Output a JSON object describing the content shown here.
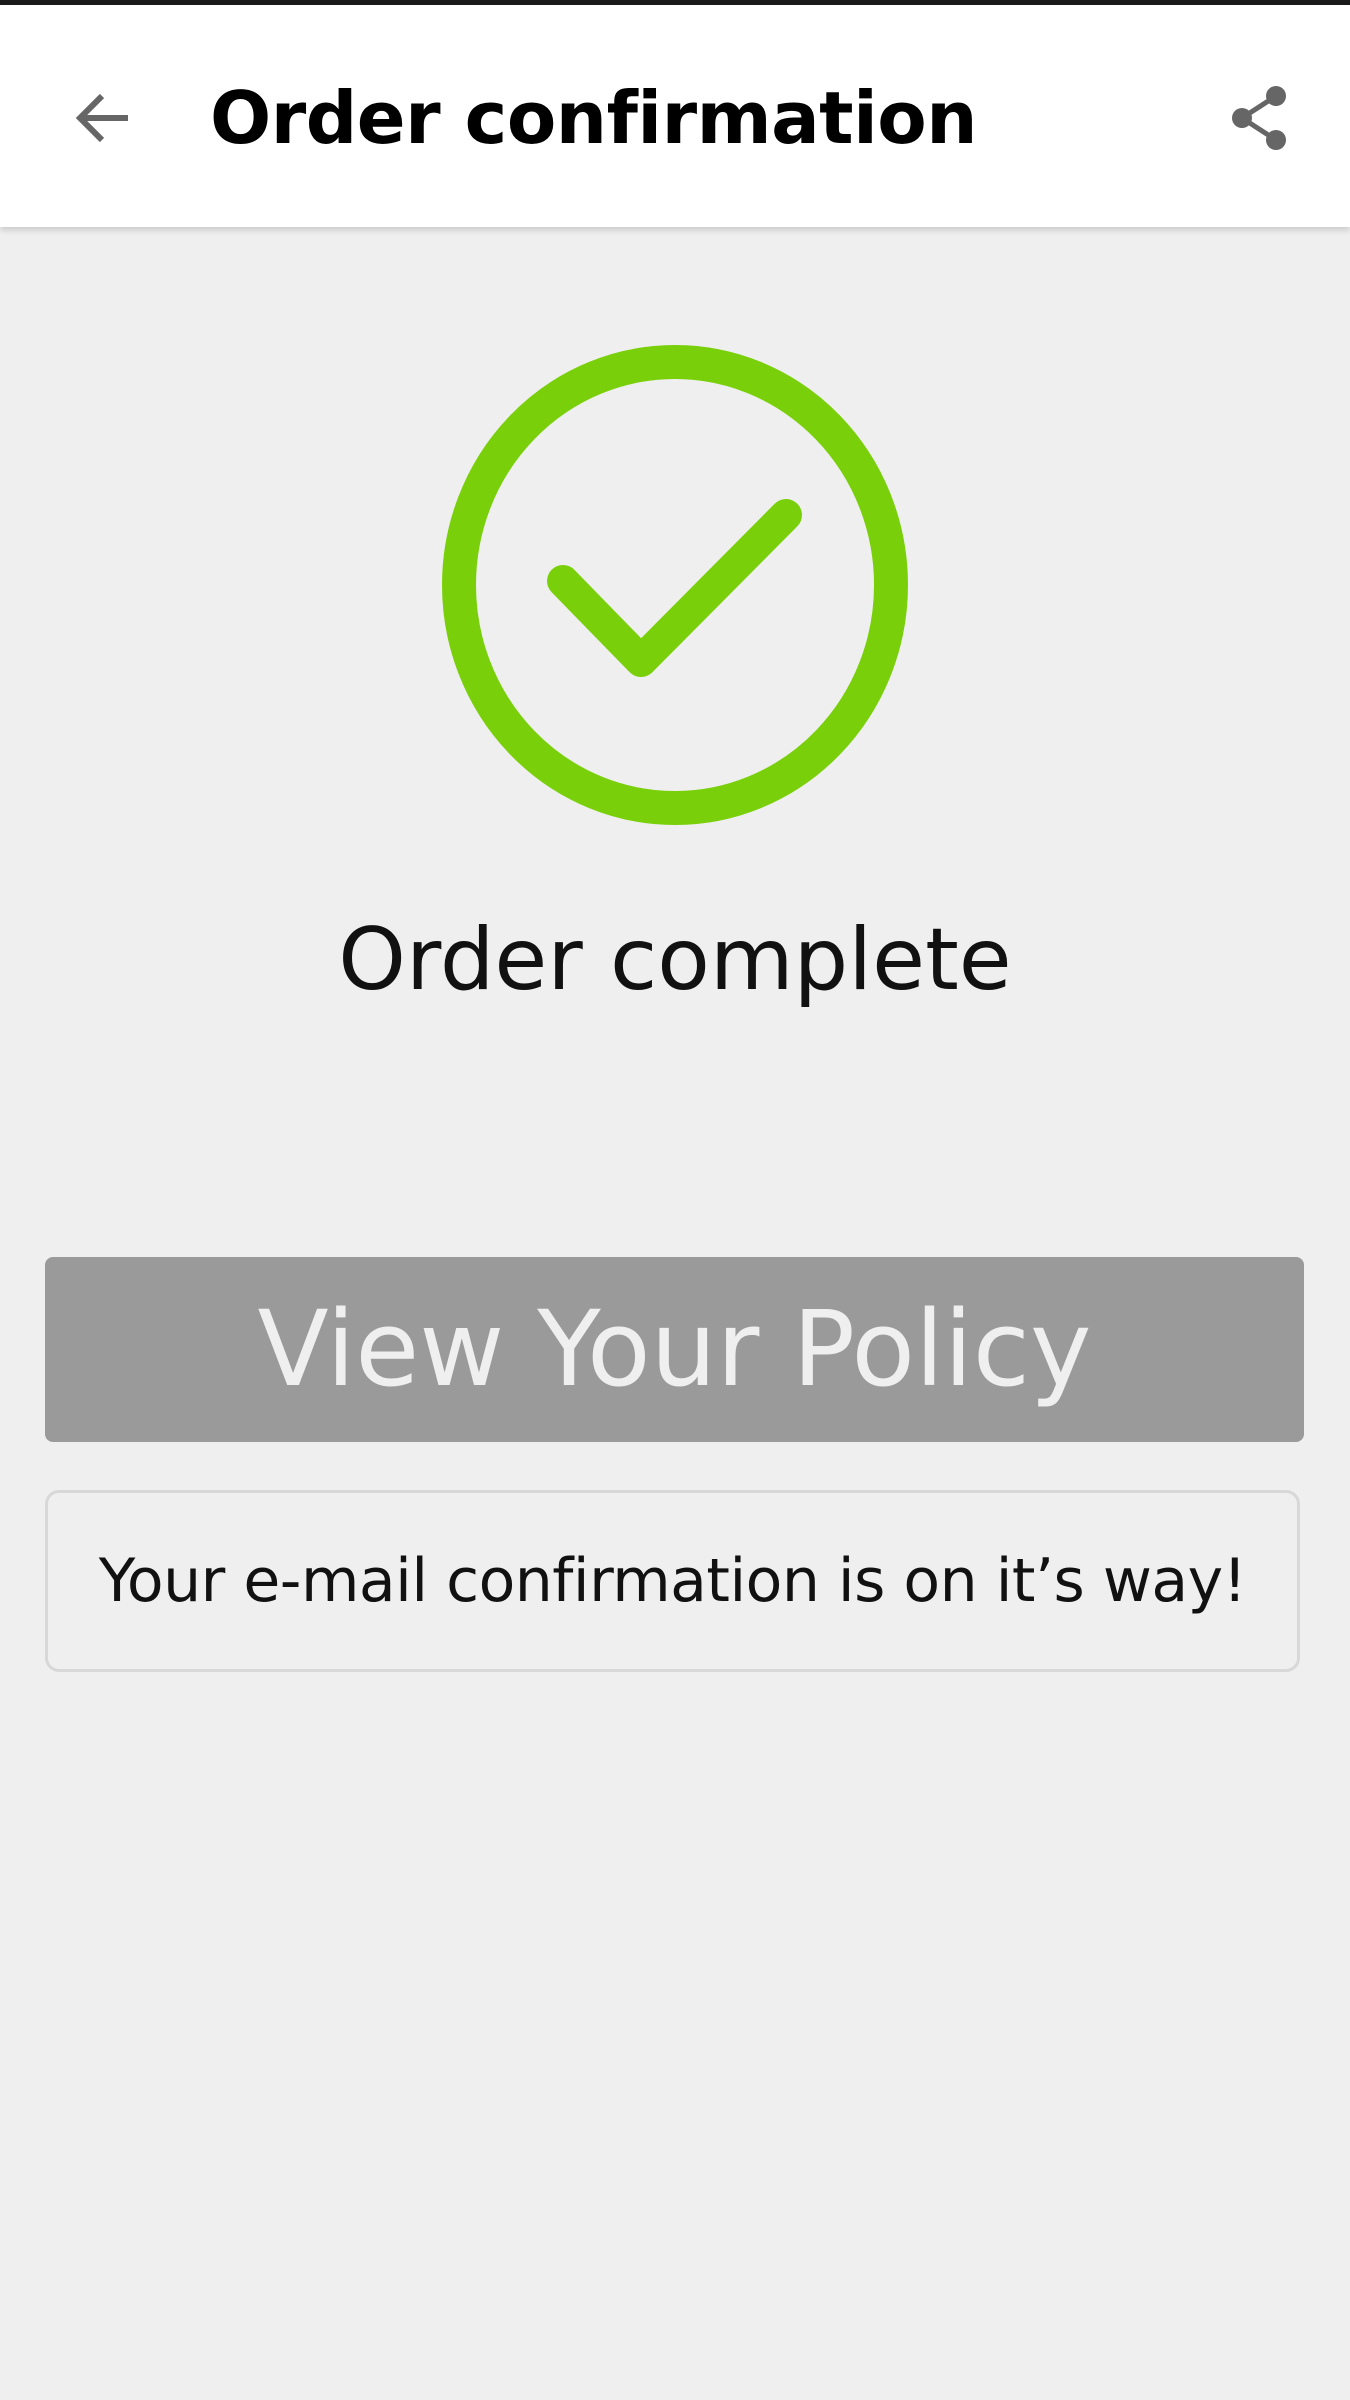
{
  "header": {
    "title": "Order confirmation",
    "back_icon": "arrow-left-icon",
    "share_icon": "share-icon"
  },
  "status": {
    "icon": "check-circle-icon",
    "message": "Order complete",
    "accent_color": "#79d00a"
  },
  "actions": {
    "view_policy_label": "View Your Policy"
  },
  "notice": {
    "text": "Your e-mail confirmation is on it’s way!"
  },
  "colors": {
    "background": "#efefef",
    "app_bar": "#ffffff",
    "button_bg": "#9a9a9a",
    "button_text": "#efefef"
  }
}
